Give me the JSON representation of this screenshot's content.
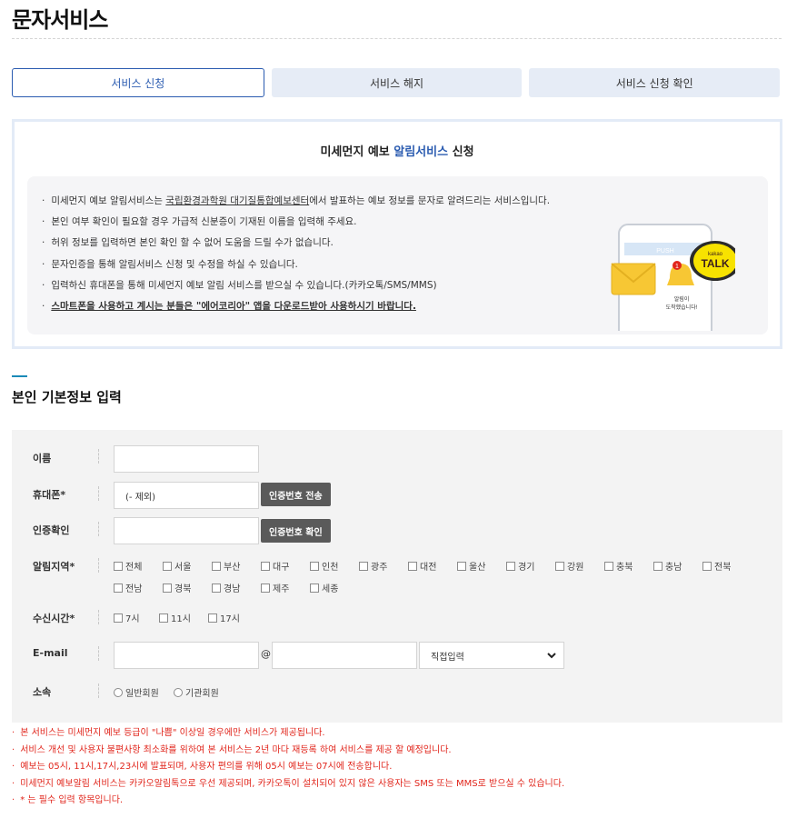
{
  "page_title": "문자서비스",
  "tabs": [
    {
      "label": "서비스 신청",
      "active": true
    },
    {
      "label": "서비스 해지",
      "active": false
    },
    {
      "label": "서비스 신청 확인",
      "active": false
    }
  ],
  "info": {
    "title_prefix": "미세먼지 예보 ",
    "title_highlight": "알림서비스",
    "title_suffix": " 신청",
    "items": {
      "item1_prefix": "미세먼지 예보 알림서비스는 ",
      "item1_underline": "국립환경과학원 대기질통합예보센터",
      "item1_suffix": "에서 발표하는 예보 정보를 문자로 알려드리는 서비스입니다.",
      "item2": "본인 여부 확인이 필요할 경우 가급적 신분증이 기재된 이름을 입력해 주세요.",
      "item3": "허위 정보를 입력하면 본인 확인 할 수 없어 도움을 드릴 수가 없습니다.",
      "item4": "문자인증을 통해 알림서비스 신청 및 수정을 하실 수 있습니다.",
      "item5": "입력하신 휴대폰을 통해 미세먼지 예보 알림 서비스를 받으실 수 있습니다.(카카오톡/SMS/MMS)",
      "item6": "스마트폰을 사용하고 계시는 분들은 \"에어코리아\" 앱을 다운로드받아 사용하시기 바랍니다."
    },
    "illustration": {
      "push_label": "PUSH",
      "kakao_small": "kakao",
      "kakao_big": "TALK",
      "badge": "1",
      "arrived_line1": "알림이",
      "arrived_line2": "도착했습니다!"
    }
  },
  "section_title": "본인 기본정보 입력",
  "form": {
    "name_label": "이름",
    "phone_label": "휴대폰*",
    "phone_placeholder": "(- 제외)",
    "send_code_button": "인증번호 전송",
    "verify_label": "인증확인",
    "verify_button": "인증번호 확인",
    "region_label": "알림지역*",
    "regions": [
      "전체",
      "서울",
      "부산",
      "대구",
      "인천",
      "광주",
      "대전",
      "울산",
      "경기",
      "강원",
      "충북",
      "충남",
      "전북",
      "전남",
      "경북",
      "경남",
      "제주",
      "세종"
    ],
    "time_label": "수신시간*",
    "times": [
      "7시",
      "11시",
      "17시"
    ],
    "email_label": "E-mail",
    "email_at": "@",
    "email_domain_select": "직접입력",
    "member_label": "소속",
    "member_types": [
      "일반회원",
      "기관회원"
    ]
  },
  "notes": [
    "본 서비스는 미세먼지 예보 등급이 \"나쁨\" 이상일 경우에만 서비스가 제공됩니다.",
    "서비스 개선 및 사용자 불편사항 최소화를 위하여 본 서비스는 2년 마다 재등록 하여 서비스를 제공 할 예정입니다.",
    "예보는 05시, 11시,17시,23시에 발표되며, 사용자 편의를 위해 05시 예보는 07시에 전송합니다.",
    "미세먼지 예보알림 서비스는 카카오알림톡으로 우선 제공되며, 카카오톡이 설치되어 있지 않은 사용자는 SMS 또는 MMS로 받으실 수 있습니다.",
    "* 는 필수 입력 항목입니다."
  ],
  "colors": {
    "accent": "#2a5bb0",
    "tab_bg": "#e6ecf6",
    "note_red": "#e1261c",
    "section_bar": "#1a8ab8"
  }
}
